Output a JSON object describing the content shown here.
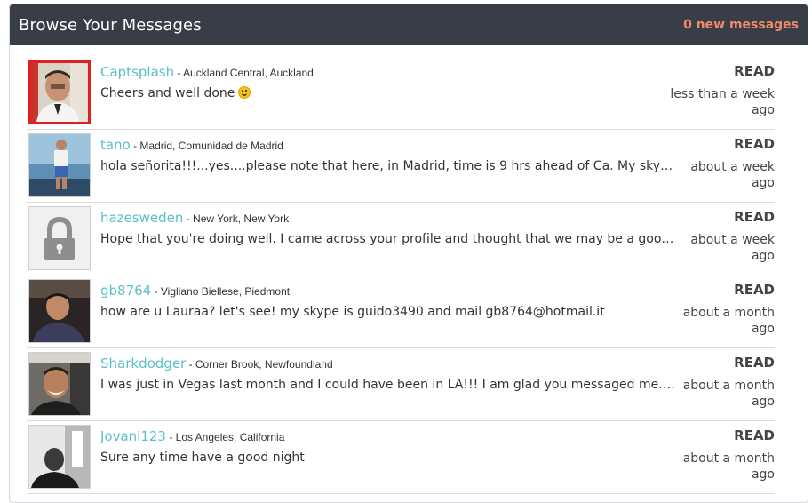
{
  "header": {
    "title": "Browse Your Messages",
    "new_messages": "0 new messages"
  },
  "messages": [
    {
      "username": "Captsplash",
      "location": " - Auckland Central, Auckland",
      "text": "Cheers and well done",
      "emoji": "smiley",
      "status": "READ",
      "time": "less than a week ago",
      "avatar": "photo-man-red-frame"
    },
    {
      "username": "tano",
      "location": " - Madrid, Comunidad de Madrid",
      "text": "hola señorita!!!...yes....please note that here, in Madrid, time is 9 hrs ahead of Ca. My skype n...",
      "status": "READ",
      "time": "about a week ago",
      "avatar": "photo-man-boat"
    },
    {
      "username": "hazesweden",
      "location": " - New York, New York",
      "text": "Hope that you're doing well. I came across your profile and thought that we may be a good m...",
      "status": "READ",
      "time": "about a week ago",
      "avatar": "lock-placeholder"
    },
    {
      "username": "gb8764",
      "location": " - Vigliano Biellese, Piedmont",
      "text": "how are u Lauraa? let's see! my skype is guido3490 and mail gb8764@hotmail.it",
      "status": "READ",
      "time": "about a month ago",
      "avatar": "photo-man-dark"
    },
    {
      "username": "Sharkdodger",
      "location": " - Corner Brook, Newfoundland",
      "text": "I was just in Vegas last month and I could have been in LA!!! I am glad you messaged me. Any...",
      "status": "READ",
      "time": "about a month ago",
      "avatar": "photo-man-car"
    },
    {
      "username": "Jovani123",
      "location": " - Los Angeles, California",
      "text": "Sure any time have a good night",
      "status": "READ",
      "time": "about a month ago",
      "avatar": "photo-man-bw"
    }
  ]
}
